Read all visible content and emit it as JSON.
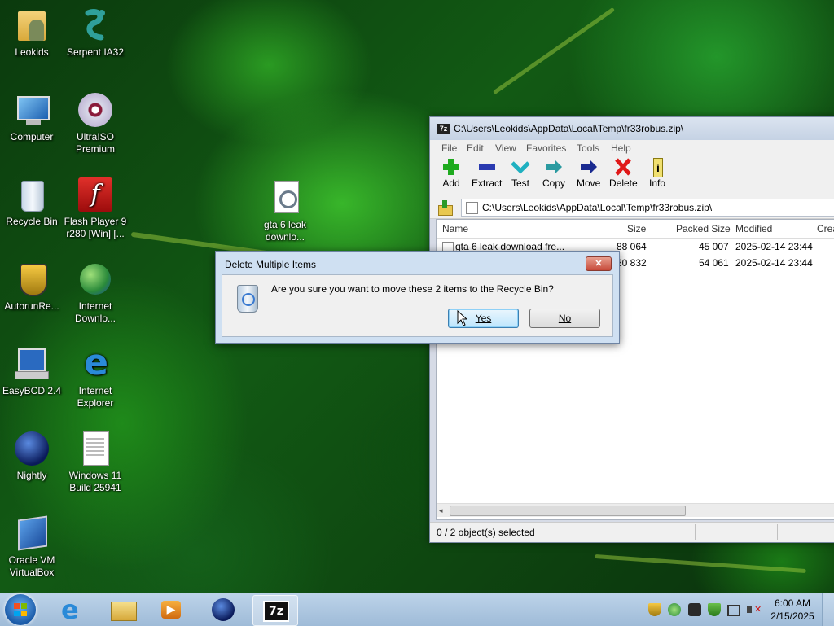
{
  "desktop": {
    "icons": [
      {
        "label": "Leokids"
      },
      {
        "label": "Serpent IA32"
      },
      {
        "label": "Computer"
      },
      {
        "label": "UltraISO Premium"
      },
      {
        "label": "Recycle Bin"
      },
      {
        "label": "Flash Player 9 r280 [Win] [..."
      },
      {
        "label": "AutorunRe..."
      },
      {
        "label": "Internet Downlo..."
      },
      {
        "label": "EasyBCD 2.4"
      },
      {
        "label": "Internet Explorer"
      },
      {
        "label": "Nightly"
      },
      {
        "label": "Windows 11 Build 25941"
      },
      {
        "label": "Oracle VM VirtualBox"
      },
      {
        "label": "gta 6 leak downlo..."
      }
    ]
  },
  "sevenzip": {
    "title": "C:\\Users\\Leokids\\AppData\\Local\\Temp\\fr33robus.zip\\",
    "menu": [
      "File",
      "Edit",
      "View",
      "Favorites",
      "Tools",
      "Help"
    ],
    "toolbar": [
      "Add",
      "Extract",
      "Test",
      "Copy",
      "Move",
      "Delete",
      "Info"
    ],
    "address": "C:\\Users\\Leokids\\AppData\\Local\\Temp\\fr33robus.zip\\",
    "columns": [
      "Name",
      "Size",
      "Packed Size",
      "Modified",
      "Crea"
    ],
    "rows": [
      {
        "name": "gta 6 leak download fre...",
        "size": "88 064",
        "packed": "45 007",
        "modified": "2025-02-14 23:44"
      },
      {
        "name": "",
        "size": "20 832",
        "packed": "54 061",
        "modified": "2025-02-14 23:44"
      }
    ],
    "status": "0 / 2 object(s) selected"
  },
  "dialog": {
    "title": "Delete Multiple Items",
    "message": "Are you sure you want to move these 2 items to the Recycle Bin?",
    "yes": "Yes",
    "no": "No",
    "close": "✕"
  },
  "taskbar": {
    "time": "6:00 AM",
    "date": "2/15/2025",
    "sevenzip_label": "7z"
  },
  "colors": {
    "accent": "#3c7fb1",
    "taskbar": "#a9c3de"
  }
}
